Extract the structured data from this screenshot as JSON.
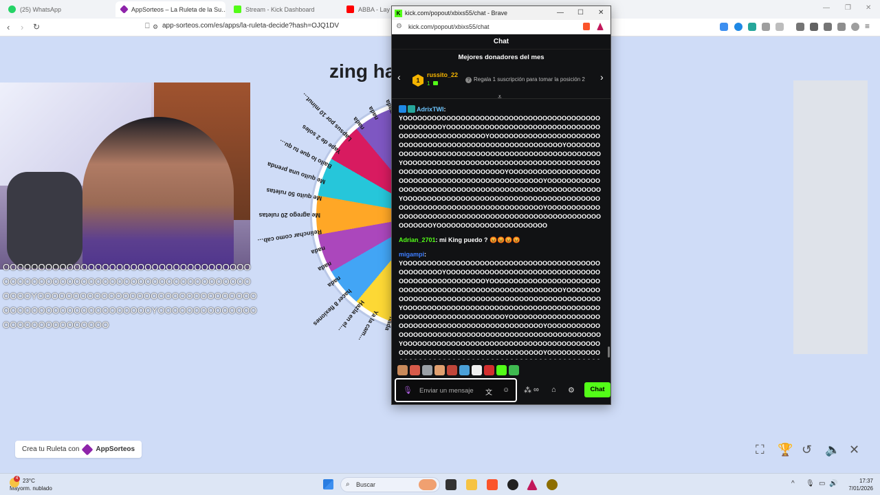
{
  "browser": {
    "tabs": [
      {
        "title": "(25) WhatsApp",
        "icon": "whatsapp-icon",
        "color": "#25d366"
      },
      {
        "title": "AppSorteos – La Ruleta de la Su…",
        "icon": "appsorteos-icon",
        "color": "#8e24aa"
      },
      {
        "title": "Stream - Kick Dashboard",
        "icon": "kick-icon",
        "color": "#53fc18"
      },
      {
        "title": "ABBA - Lay…",
        "icon": "youtube-icon",
        "color": "#ff0000"
      }
    ],
    "url": "app-sorteos.com/es/apps/la-ruleta-decide?hash=OJQ1DV"
  },
  "page": {
    "heading": "zing ha",
    "overflow_text": "OOOOOOOOOOOOOOOOOOOOOOOOOOOOOOOOOOOOOOOOOOOOOOOOOOOOOOOOOOOOOOOOOOOOOOOOOOYOOOOOOOOOOOOOOOOOOOOOOOOOOOOOOOOOOOOOOOOOOOOOOOOOOOOYOOOOOOOOOOOOOOOOOOOOOOOOOOOOO",
    "wheel_labels": [
      "nada",
      "Ya la cam…",
      "Hazla en el…",
      "hacer 8 flexiones",
      "nada",
      "nada",
      "nada",
      "Relinchar como cab…",
      "Me agrego 20 ruletas",
      "Me quito 50 ruletas",
      "Me quito una prenda",
      "Bailo lo que tu qu…",
      "Yape de 2 soles",
      "Lapsus por 10 minut…",
      "nada",
      "nada",
      "nada"
    ],
    "credit_text": "Crea tu Ruleta con",
    "credit_brand": "AppSorteos"
  },
  "popout": {
    "window_title": "kick.com/popout/xbixs55/chat - Brave",
    "url": "kick.com/popout/xbixs55/chat",
    "chat_header": "Chat",
    "donors_title": "Mejores donadores del mes",
    "donor": {
      "rank": "1",
      "name": "russito_22",
      "count": "1"
    },
    "donor_hint": "Regala 1 suscripción para tomar la posición 2",
    "messages": [
      {
        "user": "AdrixTWI",
        "user_color": "#6ec6ff",
        "text": "YOOOOOOOOOOOOOOOOOOOOOOOOOOOOOOOOOOOOOOOOOOOOOOOOOOYOOOOOOOOOOOOOOOOOOOOOOOOOOOOOOOOOOOOOOOOOOOOOOOOOOYOOOOOOOOOOOOOOOOOOOOOOOOOOOOOOOOOOOOOOOOOOOOOOOOOOOOOOOOOYOOOOOOOOOOOOOOOOOOOOOOOOOOOOOOOOOOOOOOOOOOOOOOOOOYOOOOOOOOOOOOOOOOOOOOOOOOOOOOOOOOOOOOOOOOOOOOOOOOOOOOOOOOOOOOOOOYOOOOOOOOOOOOOOOOOOOOOOOOOOOOOOOOOOOOOOOOOOOOOOOOOYOOOOOOOOOOOOOOOOOOOOOOOOOOOOOOOOOOOOOOOOOOOOOOOOOOOOOYOOOOOOOOOOOOOOOOOOOOOOOOOOOOOOOOOOOOOOOOOOOOOOOOOOOOOOOOOOOOOOOOOOOOOOOYOOOOOOOOOOOOOOOOOOOOOOOOOOOOOOOOOOOOOOOOOOOOOOOOOOOOOOOOOOOOYOOOOOOOOOOOOOOOOOOOOOOO"
      },
      {
        "user": "Adrian_2701",
        "user_color": "#53fc18",
        "text": "mi King puedo ? 😡😡😡😡"
      },
      {
        "user": "migampi",
        "user_color": "#3d7dff",
        "text": "YOOOOOOOOOOOOOOOOOOOOOOOOOOOOOOOOOOOOOOOOOOOOOOOOOOYOOOOOOOOOOOOOOOOOOOOOOOOOOOOOOOOOOOOOOOOOOOOOOOOOOYOOOOOOOOOOOOOOOOOOOOOOOOOOOOOOOOOOOOOOOOOOOOOOOOOOOOOOOOOYOOOOOOOOOOOOOOOOOOOOOOOOOOOOOOOOOOOOOOOOOOOOOOOOOYOOOOOOOOOOOOOOOOOOOOOOOOOOOOOOOOOOOOOOOOOOOOOOOOOOOOOOOOOOOOOOOYOOOOOOOOOOOOOOOOOOOOOOOOOOOOOOOOOOOOOOOOOOOOOOOOOYOOOOOOOOOOOOOOOOOOOOOOOOOOOOOOOOOOOOOOOOOOOOOOOOOOOOOYOOOOOOOOOOOOOOOOOOOOOOOOOOOOOOOOOOOOOOOOOOOOOOOOOOOOOOOOOOOOOOOOOOOOOOOYOOOOOOOOOOOOOOOOOOOOOOOOOOOOOOOOOOOOOOOOOOOOOOOOOOOOOOOOOOOOYOOOOOOOOOOOOOOOOOOOOOOO"
      }
    ],
    "input_placeholder": "Enviar un mensaje",
    "send_label": "Chat",
    "emote_colors": [
      "#c98a5b",
      "#d65a4a",
      "#9aa0a6",
      "#e0a070",
      "#c0463a",
      "#4aa0d8",
      "#f0f0f0",
      "#d32f2f",
      "#53fc18",
      "#3fb950"
    ]
  },
  "taskbar": {
    "temperature": "23°C",
    "weather": "Mayorm. nublado",
    "weather_alerts": "4",
    "search_placeholder": "Buscar",
    "time": "17:37",
    "date": "7/01/2026"
  }
}
